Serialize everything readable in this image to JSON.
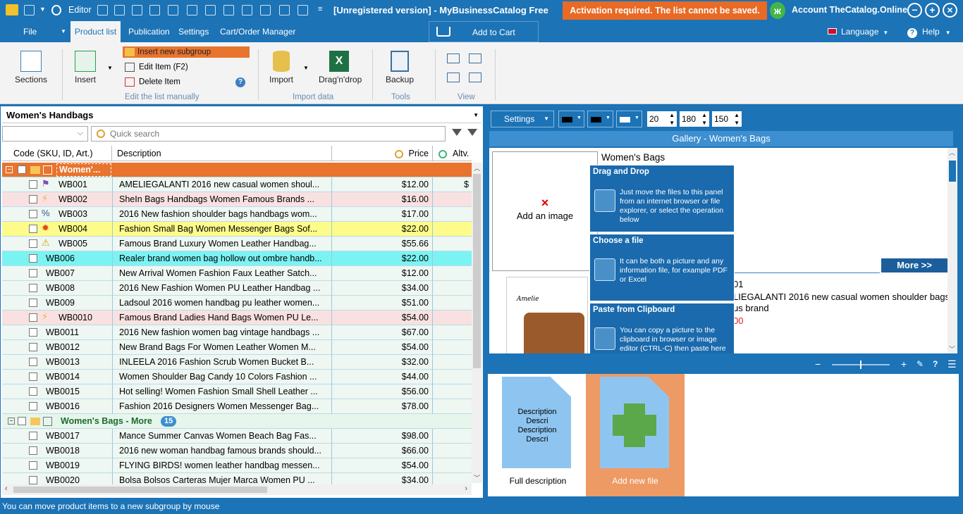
{
  "titlebar": {
    "editor_label": "Editor",
    "title": "[Unregistered version] - MyBusinessCatalog Free",
    "activation": "Activation required. The list cannot be saved.",
    "account": "Account TheCatalog.Online",
    "logo_letter": "ж"
  },
  "menu": {
    "file": "File",
    "product_list": "Product list",
    "publication": "Publication",
    "settings": "Settings",
    "cart": "Cart/Order Manager",
    "add_to_cart": "Add to Cart",
    "language": "Language",
    "help": "Help"
  },
  "ribbon": {
    "sections": "Sections",
    "insert": "Insert",
    "insert_subgroup": "Insert new subgroup",
    "edit_item": "Edit Item  (F2)",
    "delete_item": "Delete Item",
    "group_edit": "Edit the list manually",
    "import": "Import",
    "dragdrop": "Drag'n'drop",
    "group_import": "Import data",
    "backup": "Backup",
    "group_tools": "Tools",
    "group_view": "View"
  },
  "list": {
    "category": "Women's Handbags",
    "search_placeholder": "Quick search",
    "col_code": "Code (SKU, ID, Art.)",
    "col_desc": "Description",
    "col_price": "Price",
    "col_alt": "Altv. pr",
    "group1": "Women'...",
    "group2": "Women's Bags - More",
    "group2_count": "15",
    "rows": [
      {
        "code": "WB001",
        "desc": "AMELIEGALANTI 2016 new casual women shoul...",
        "price": "$12.00",
        "extra": "$"
      },
      {
        "code": "WB002",
        "desc": "SheIn Bags Handbags Women Famous Brands ...",
        "price": "$16.00"
      },
      {
        "code": "WB003",
        "desc": "2016 New fashion shoulder bags handbags wom...",
        "price": "$17.00"
      },
      {
        "code": "WB004",
        "desc": "Fashion Small Bag Women Messenger Bags Sof...",
        "price": "$22.00"
      },
      {
        "code": "WB005",
        "desc": "Famous Brand Luxury Women Leather Handbag...",
        "price": "$55.66"
      },
      {
        "code": "WB006",
        "desc": "Realer brand women bag hollow out ombre handb...",
        "price": "$22.00"
      },
      {
        "code": "WB007",
        "desc": "New Arrival Women Fashion Faux Leather Satch...",
        "price": "$12.00"
      },
      {
        "code": "WB008",
        "desc": "2016 New Fashion Women PU Leather Handbag ...",
        "price": "$34.00"
      },
      {
        "code": "WB009",
        "desc": "Ladsoul 2016 women handbag pu leather women...",
        "price": "$51.00"
      },
      {
        "code": "WB0010",
        "desc": "Famous Brand Ladies Hand Bags Women PU Le...",
        "price": "$54.00"
      },
      {
        "code": "WB0011",
        "desc": "2016 New fashion women bag vintage handbags ...",
        "price": "$67.00"
      },
      {
        "code": "WB0012",
        "desc": "New Brand Bags For Women Leather Women M...",
        "price": "$54.00"
      },
      {
        "code": "WB0013",
        "desc": "INLEELA 2016 Fashion Scrub Women Bucket B...",
        "price": "$32.00"
      },
      {
        "code": "WB0014",
        "desc": "Women Shoulder Bag Candy 10 Colors Fashion ...",
        "price": "$44.00"
      },
      {
        "code": "WB0015",
        "desc": "Hot selling! Women Fashion Small Shell Leather ...",
        "price": "$56.00"
      },
      {
        "code": "WB0016",
        "desc": "Fashion 2016 Designers Women Messenger Bag...",
        "price": "$78.00"
      }
    ],
    "rows2": [
      {
        "code": "WB0017",
        "desc": "Mance Summer Canvas Women Beach Bag Fas...",
        "price": "$98.00"
      },
      {
        "code": "WB0018",
        "desc": "2016 new woman handbag famous brands should...",
        "price": "$66.00"
      },
      {
        "code": "WB0019",
        "desc": "FLYING BIRDS! women leather handbag messen...",
        "price": "$54.00"
      },
      {
        "code": "WB0020",
        "desc": "Bolsa Bolsos Carteras Mujer Marca Women PU ...",
        "price": "$34.00"
      }
    ]
  },
  "right": {
    "settings": "Settings",
    "num1": "20",
    "num2": "180",
    "num3": "150",
    "gallery_title": "Gallery - Women's Bags",
    "gallery_name": "Women's Bags",
    "add_image": "Add an image",
    "more": "More >>",
    "detail_code": "01",
    "detail_desc": "LIEGALANTI 2016 new casual women shoulder bags",
    "detail_brand": "us brand",
    "detail_price": "00",
    "brand_logo": "Amelie",
    "tip1_title": "Drag and Drop",
    "tip1_text": "Just move the files to this panel from an internet browser or file explorer, or select the operation below",
    "tip2_title": "Choose a file",
    "tip2_text": "It can be both a picture and any information file, for example PDF or Excel",
    "tip3_title": "Paste from Clipboard",
    "tip3_text": "You can copy a picture to the clipboard in browser or image editor (CTRL-C) then paste here",
    "full_desc_doc": "Description Descri Description Descri",
    "full_desc": "Full description",
    "add_new_file": "Add new file"
  },
  "status": "You can move product items to a new subgroup by mouse"
}
